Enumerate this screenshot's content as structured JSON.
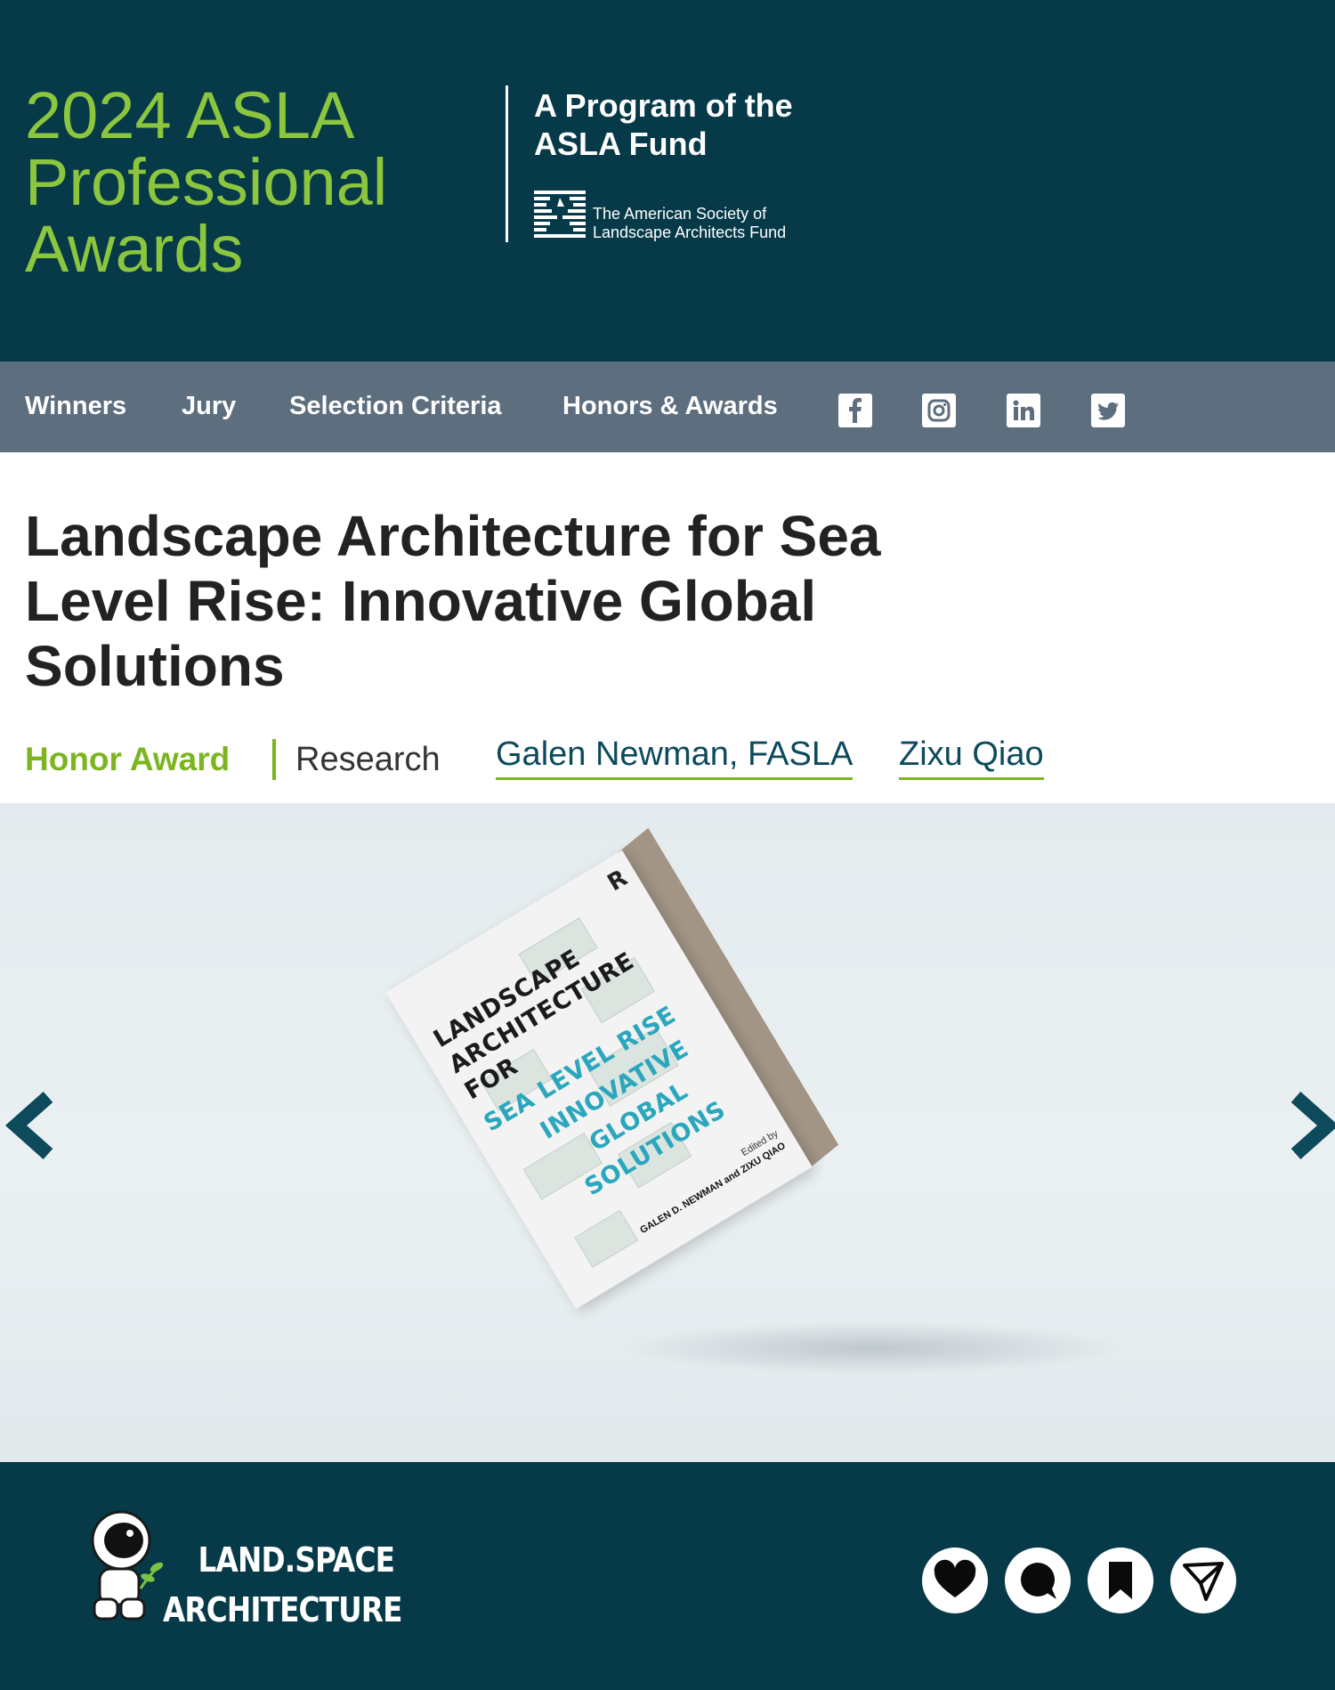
{
  "header": {
    "title_lines": [
      "2024 ASLA",
      "Professional",
      "Awards"
    ],
    "program_lines": [
      "A Program of the",
      "ASLA Fund"
    ],
    "fund_name_lines": [
      "The American Society of",
      "Landscape Architects Fund"
    ]
  },
  "nav": {
    "items": [
      {
        "label": "Winners"
      },
      {
        "label": "Jury"
      },
      {
        "label": "Selection Criteria"
      },
      {
        "label": "Honors & Awards"
      }
    ],
    "social": [
      {
        "icon": "facebook-icon"
      },
      {
        "icon": "instagram-icon"
      },
      {
        "icon": "linkedin-icon"
      },
      {
        "icon": "twitter-icon"
      }
    ]
  },
  "project": {
    "title": "Landscape Architecture for Sea Level Rise: Innovative Global Solutions",
    "award_level": "Honor Award",
    "category": "Research",
    "authors": [
      "Galen Newman, FASLA",
      "Zixu Qiao"
    ]
  },
  "carousel": {
    "prev_icon": "chevron-left-icon",
    "next_icon": "chevron-right-icon",
    "book_cover": {
      "publisher_mark": "R",
      "dark_lines": [
        "LANDSCAPE",
        "ARCHITECTURE",
        "FOR"
      ],
      "teal_lines": [
        "SEA LEVEL RISE",
        "INNOVATIVE",
        "GLOBAL",
        "SOLUTIONS"
      ],
      "edited_by": "Edited by",
      "editors": "GALEN D. NEWMAN and ZIXU QIAO"
    }
  },
  "footer": {
    "brand_lines": [
      "LAND.SPACE",
      "ARCHITECTURE"
    ],
    "actions": [
      {
        "icon": "heart-icon"
      },
      {
        "icon": "comment-icon"
      },
      {
        "icon": "bookmark-icon"
      },
      {
        "icon": "send-icon"
      }
    ]
  },
  "colors": {
    "header_bg": "#063a48",
    "nav_bg": "#5d6e7e",
    "accent_green": "#8cc63f",
    "link_teal": "#0d4a5c"
  }
}
